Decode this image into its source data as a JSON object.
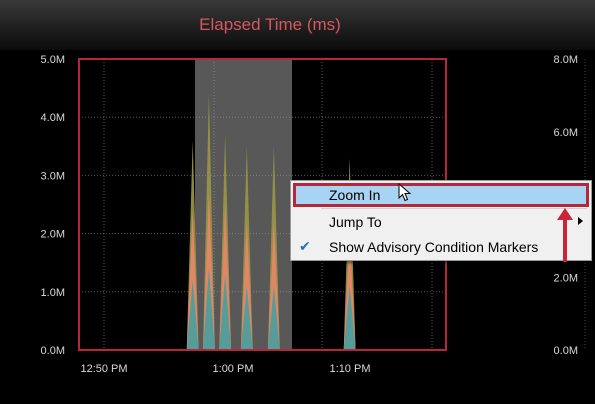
{
  "header": {
    "title": "Elapsed Time (ms)"
  },
  "chart_data": {
    "type": "area",
    "left_axis_ticks": [
      "5.0M",
      "4.0M",
      "3.0M",
      "2.0M",
      "1.0M",
      "0.0M"
    ],
    "right_axis_ticks": [
      "8.0M",
      "6.0M",
      "4.0M",
      "2.0M",
      "0.0M"
    ],
    "x_ticks": [
      "12:50 PM",
      "1:00 PM",
      "1:10 PM"
    ],
    "ylim": [
      0,
      5000000
    ],
    "grid": true,
    "selection_highlighted": true,
    "series": [
      {
        "color": "#9a9545",
        "peaks": [
          [
            13,
            3600000
          ],
          [
            14.5,
            4400000
          ],
          [
            16,
            3700000
          ],
          [
            18,
            3500000
          ],
          [
            20.5,
            3500000
          ],
          [
            27.5,
            3300000
          ]
        ]
      },
      {
        "color": "#e6876a",
        "peaks": [
          [
            13,
            2400000
          ],
          [
            14.5,
            2700000
          ],
          [
            16,
            2500000
          ],
          [
            18,
            2200000
          ],
          [
            20.5,
            2200000
          ],
          [
            27.5,
            2000000
          ]
        ]
      },
      {
        "color": "#4a9e9e",
        "peaks": [
          [
            13,
            1200000
          ],
          [
            14.5,
            1400000
          ],
          [
            16,
            1300000
          ],
          [
            18,
            1100000
          ],
          [
            20.5,
            1100000
          ],
          [
            27.5,
            1100000
          ]
        ]
      }
    ]
  },
  "context_menu": {
    "items": [
      {
        "label": "Zoom In"
      },
      {
        "label": "Jump To"
      },
      {
        "label": "Show Advisory Condition Markers"
      }
    ]
  },
  "colors": {
    "frame": "#b5283c",
    "menu_highlight": "#a9d3f2"
  }
}
